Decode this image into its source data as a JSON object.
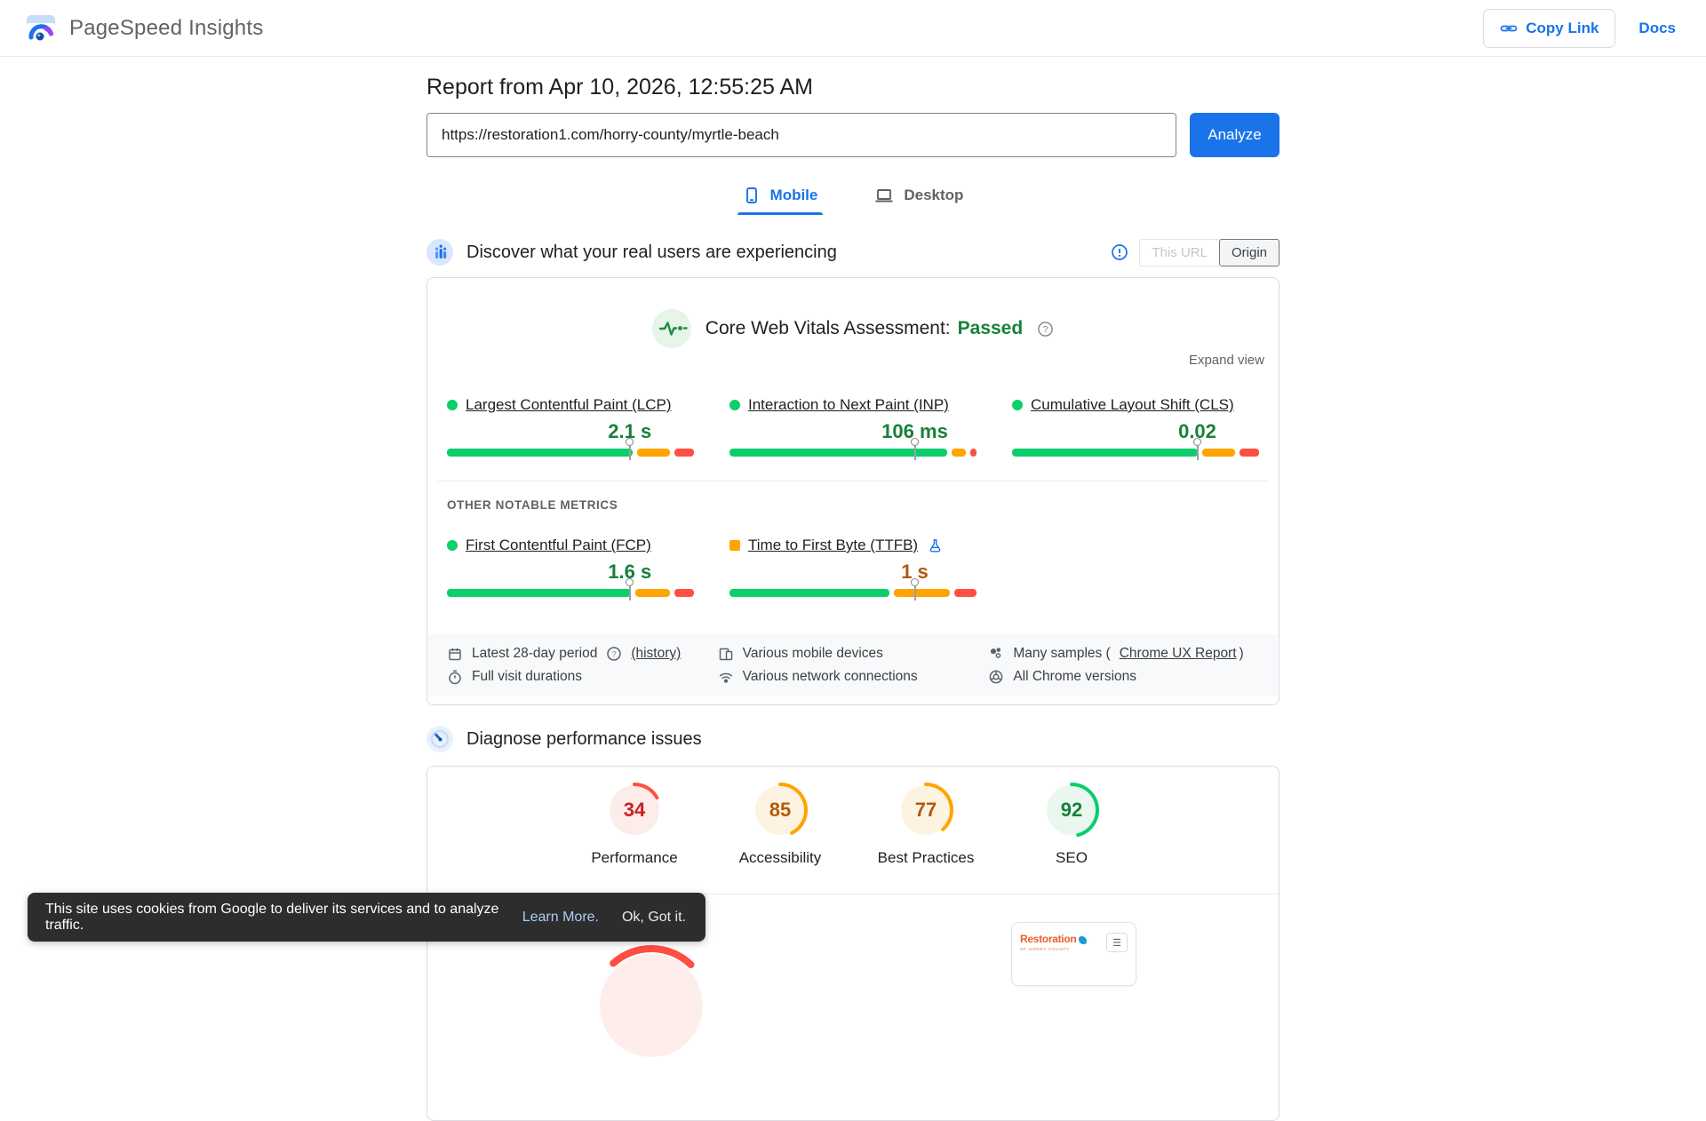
{
  "header": {
    "title": "PageSpeed Insights",
    "copy_link": "Copy Link",
    "docs": "Docs"
  },
  "report": {
    "title": "Report from Apr 10, 2026, 12:55:25 AM",
    "url": "https://restoration1.com/horry-county/myrtle-beach",
    "analyze": "Analyze"
  },
  "tabs": {
    "mobile": "Mobile",
    "desktop": "Desktop"
  },
  "field": {
    "heading": "Discover what your real users are experiencing",
    "toggle_this_url": "This URL",
    "toggle_origin": "Origin",
    "assessment_label": "Core Web Vitals Assessment:",
    "assessment_value": "Passed",
    "expand_view": "Expand view",
    "other_metrics_label": "OTHER NOTABLE METRICS",
    "core_metrics": [
      {
        "id": "lcp",
        "name": "Largest Contentful Paint (LCP)",
        "value": "2.1 s",
        "value_color": "#188038",
        "bullet_shape": "circle",
        "bullet_color": "#0cce6b",
        "segments": [
          75,
          13,
          8
        ],
        "marker": 74
      },
      {
        "id": "inp",
        "name": "Interaction to Next Paint (INP)",
        "value": "106 ms",
        "value_color": "#188038",
        "bullet_shape": "circle",
        "bullet_color": "#0cce6b",
        "segments": [
          89,
          6,
          2.5
        ],
        "marker": 75
      },
      {
        "id": "cls",
        "name": "Cumulative Layout Shift (CLS)",
        "value": "0.02",
        "value_color": "#188038",
        "bullet_shape": "circle",
        "bullet_color": "#0cce6b",
        "segments": [
          75,
          13,
          8
        ],
        "marker": 75
      }
    ],
    "other_metrics": [
      {
        "id": "fcp",
        "name": "First Contentful Paint (FCP)",
        "value": "1.6 s",
        "value_color": "#188038",
        "bullet_shape": "circle",
        "bullet_color": "#0cce6b",
        "segments": [
          75,
          14,
          8
        ],
        "marker": 74
      },
      {
        "id": "ttfb",
        "name": "Time to First Byte (TTFB)",
        "value": "1 s",
        "value_color": "#b3590a",
        "bullet_shape": "square",
        "bullet_color": "#ffa400",
        "segments": [
          65,
          23,
          9
        ],
        "marker": 75,
        "experimental": true
      }
    ],
    "meta": [
      {
        "icon": "calendar",
        "text": "Latest 28-day period",
        "help": true,
        "link": "(history)"
      },
      {
        "icon": "devices",
        "text": "Various mobile devices"
      },
      {
        "icon": "samples",
        "text": "Many samples (",
        "link": "Chrome UX Report",
        "suffix": ")"
      },
      {
        "icon": "timer",
        "text": "Full visit durations"
      },
      {
        "icon": "network",
        "text": "Various network connections"
      },
      {
        "icon": "chrome",
        "text": "All Chrome versions"
      }
    ]
  },
  "lab": {
    "heading": "Diagnose performance issues",
    "scores": [
      {
        "value": 34,
        "label": "Performance",
        "text_color": "#c7221f",
        "arc_color": "#ff4e42",
        "bg_color": "#fcecea"
      },
      {
        "value": 85,
        "label": "Accessibility",
        "text_color": "#b3590a",
        "arc_color": "#ffa400",
        "bg_color": "#fdf3e1"
      },
      {
        "value": 77,
        "label": "Best Practices",
        "text_color": "#b3590a",
        "arc_color": "#ffa400",
        "bg_color": "#fdf3e1"
      },
      {
        "value": 92,
        "label": "SEO",
        "text_color": "#188038",
        "arc_color": "#0cce6b",
        "bg_color": "#e9f7ee"
      }
    ]
  },
  "preview": {
    "brand": "Restoration",
    "brand_sub": "OF HORRY COUNTY"
  },
  "cookie": {
    "text": "This site uses cookies from Google to deliver its services and to analyze traffic.",
    "learn_more": "Learn More.",
    "ok": "Ok, Got it."
  },
  "colors": {
    "accent": "#1a73e8",
    "pass_green": "#188038",
    "bar_green": "#0cce6b",
    "bar_orange": "#ffa400",
    "bar_red": "#ff4e42"
  }
}
